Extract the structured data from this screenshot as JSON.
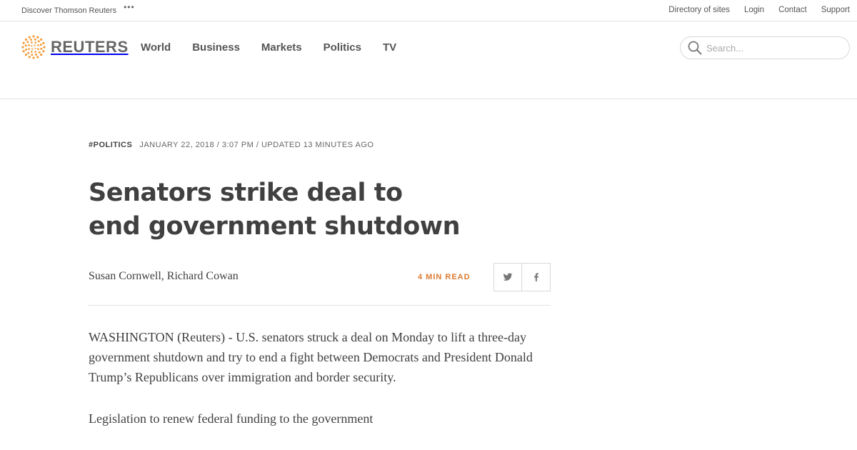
{
  "utility": {
    "discover": "Discover Thomson Reuters",
    "dots": "•••",
    "links": [
      "Directory of sites",
      "Login",
      "Contact",
      "Support"
    ]
  },
  "brand": {
    "name": "REUTERS",
    "accent": "#f39c3a"
  },
  "nav": {
    "items": [
      "World",
      "Business",
      "Markets",
      "Politics",
      "TV"
    ]
  },
  "search": {
    "placeholder": "Search...",
    "value": ""
  },
  "article": {
    "tag": "#Politics",
    "date": "January 22, 2018 / 3:07 PM / Updated 13 minutes ago",
    "headline": "Senators strike deal to end government shutdown",
    "byline": "Susan Cornwell, Richard Cowan",
    "read_time": "4 MIN READ",
    "paragraphs": [
      "WASHINGTON (Reuters) - U.S. senators struck a deal on Monday to lift a three-day government shutdown and try to end a fight between Democrats and President Donald Trump’s Republicans over immigration and border security.",
      "Legislation to renew federal funding to the government"
    ]
  },
  "share": {
    "icons": [
      "twitter-icon",
      "facebook-icon"
    ]
  }
}
